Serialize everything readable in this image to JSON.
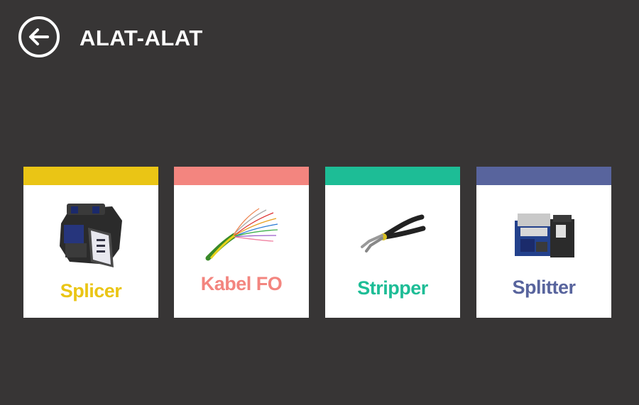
{
  "header": {
    "title": "ALAT-ALAT",
    "back_icon": "arrow-left-icon"
  },
  "cards": [
    {
      "label": "Splicer",
      "color": "#eac515",
      "icon": "fusion-splicer-image"
    },
    {
      "label": "Kabel FO",
      "color": "#f3857f",
      "icon": "fiber-optic-cable-image"
    },
    {
      "label": "Stripper",
      "color": "#1dbd96",
      "icon": "stripper-pliers-image"
    },
    {
      "label": "Splitter",
      "color": "#58649d",
      "icon": "fiber-cleaver-image"
    }
  ]
}
